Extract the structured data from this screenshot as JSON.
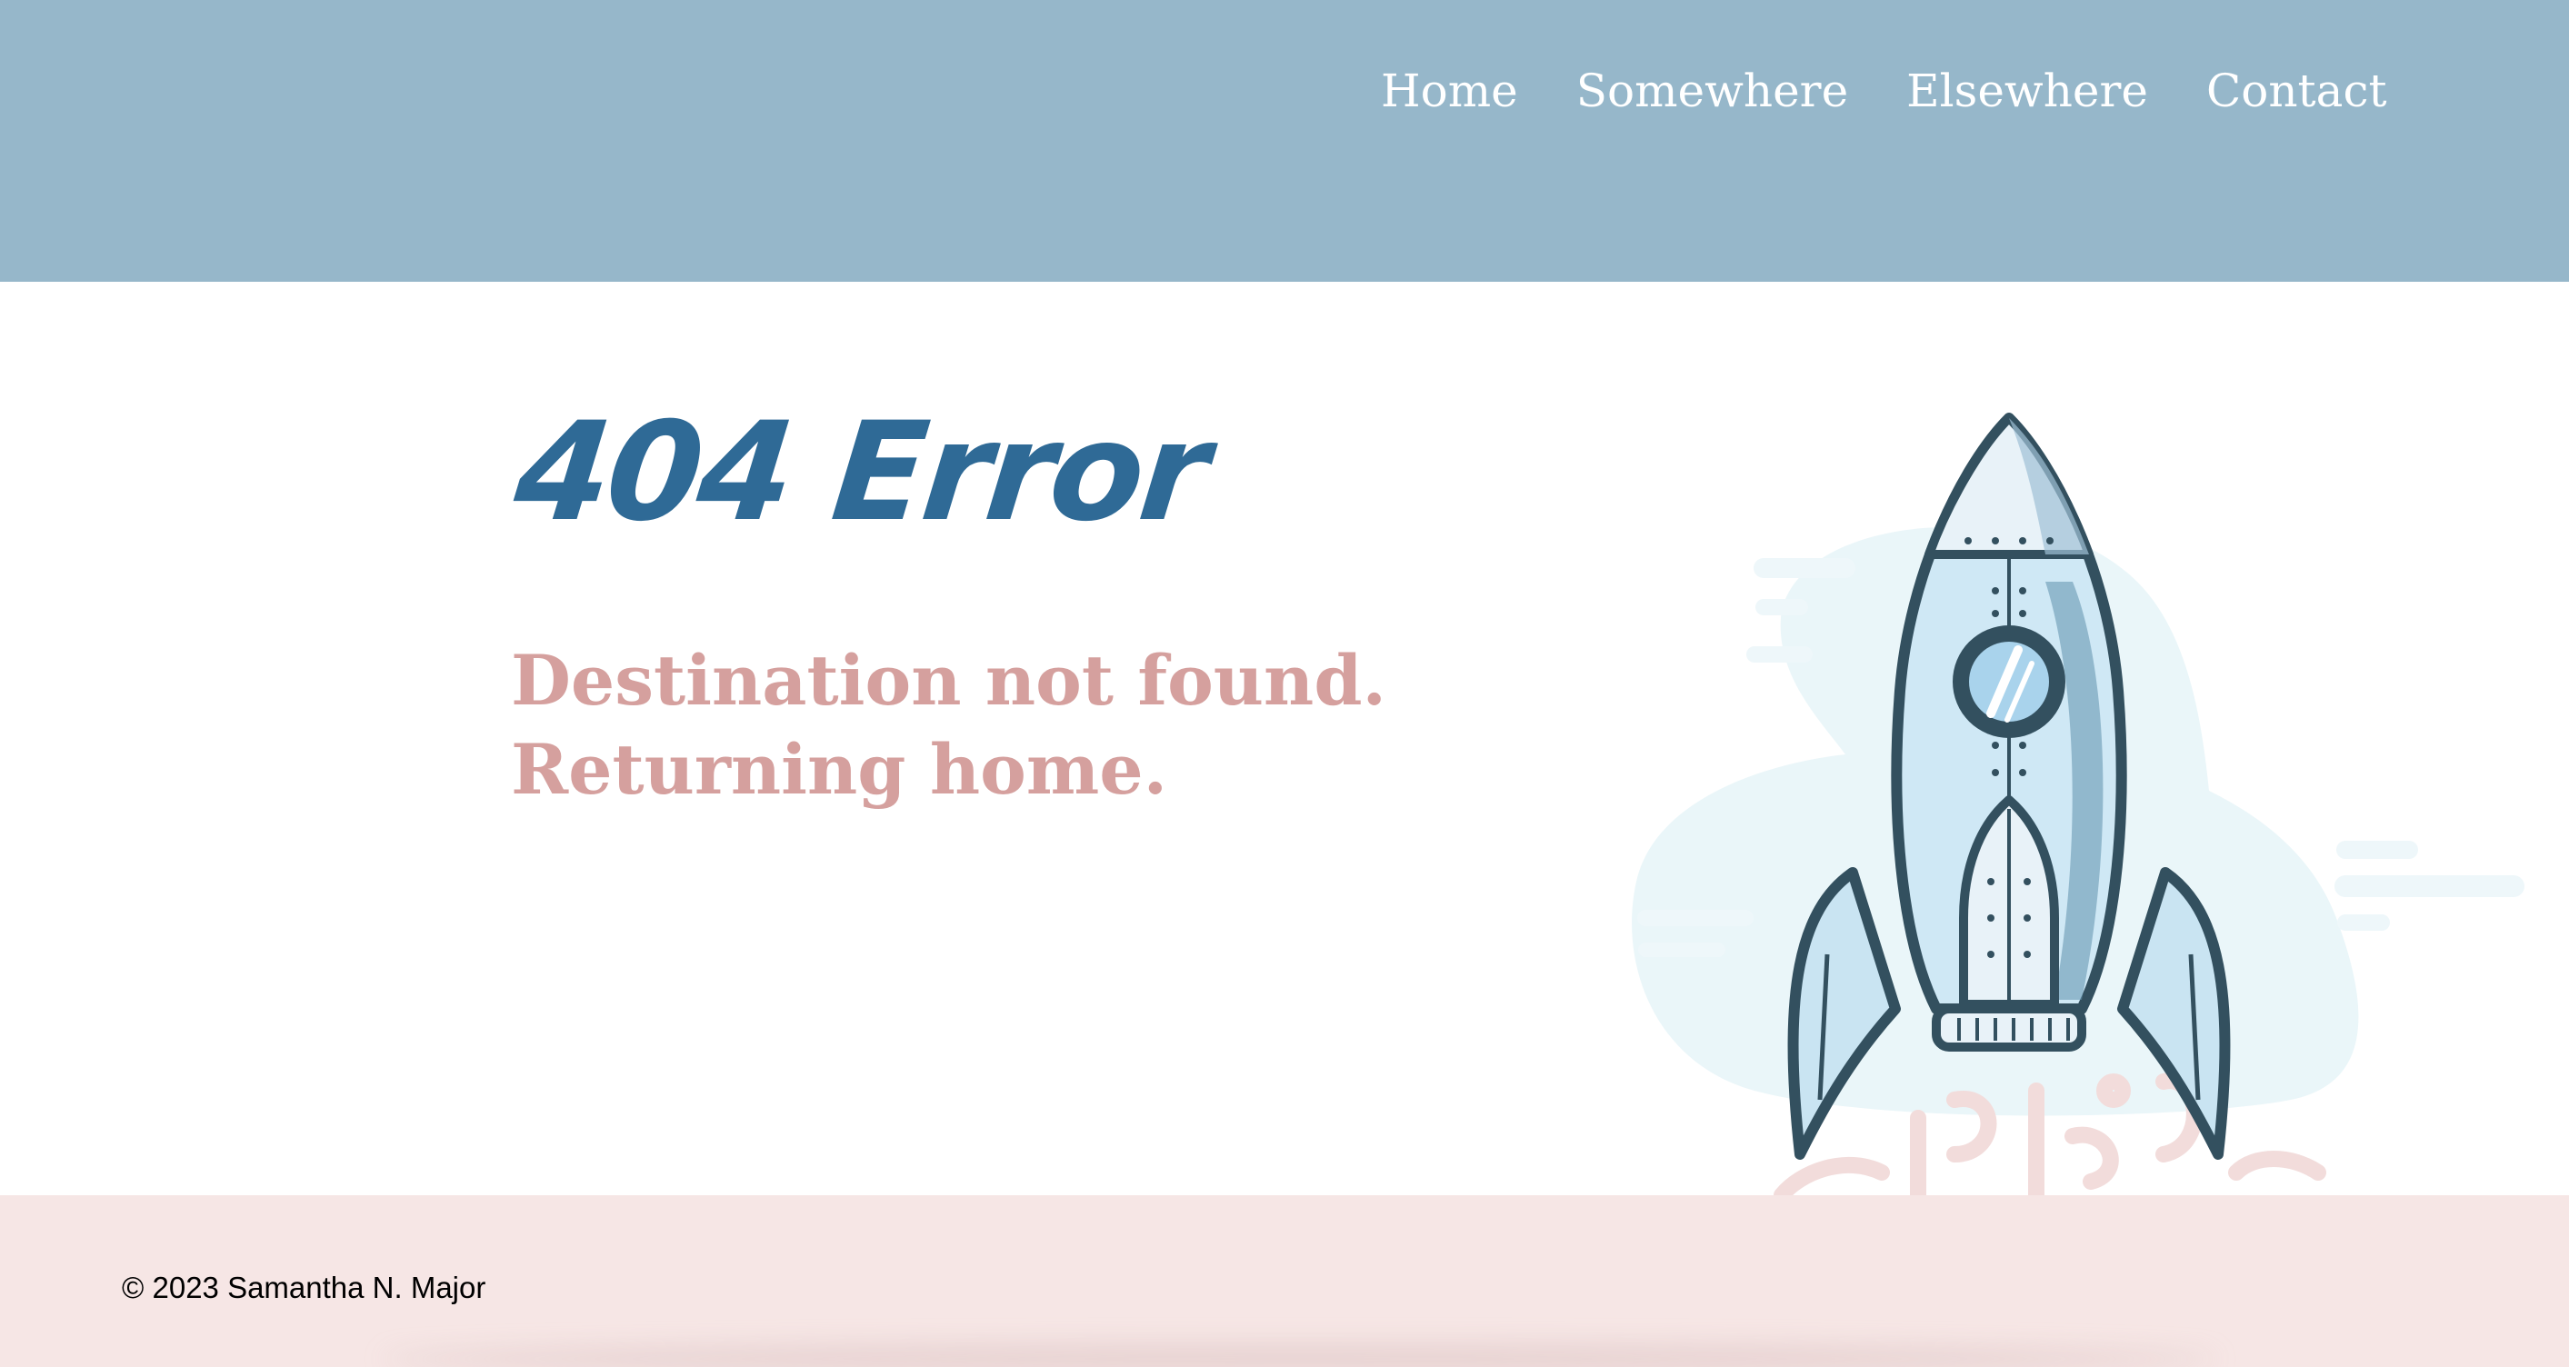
{
  "nav": {
    "items": [
      "Home",
      "Somewhere",
      "Elsewhere",
      "Contact"
    ]
  },
  "main": {
    "title": "404 Error",
    "message_line1": "Destination not found.",
    "message_line2": "Returning home."
  },
  "footer": {
    "copyright": "© 2023 Samantha N. Major"
  },
  "colors": {
    "header_bg": "#96b7ca",
    "title": "#2f6a96",
    "message": "#d5a09e",
    "footer_bg": "#f6e6e5"
  },
  "illustration": "rocket-illustration"
}
